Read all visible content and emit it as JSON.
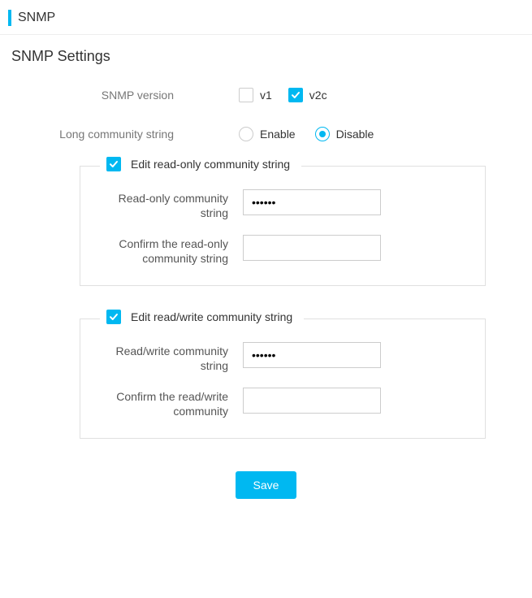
{
  "header": {
    "title": "SNMP"
  },
  "subtitle": "SNMP Settings",
  "version_row": {
    "label": "SNMP version",
    "options": [
      {
        "label": "v1",
        "checked": false
      },
      {
        "label": "v2c",
        "checked": true
      }
    ]
  },
  "longcomm_row": {
    "label": "Long community string",
    "options": [
      {
        "label": "Enable",
        "selected": false
      },
      {
        "label": "Disable",
        "selected": true
      }
    ]
  },
  "panels": {
    "readonly": {
      "legend": "Edit read-only community string",
      "legend_checked": true,
      "fields": [
        {
          "label": "Read-only community string",
          "value": "••••••"
        },
        {
          "label": "Confirm the read-only community string",
          "value": ""
        }
      ]
    },
    "readwrite": {
      "legend": "Edit read/write community string",
      "legend_checked": true,
      "fields": [
        {
          "label": "Read/write community string",
          "value": "••••••"
        },
        {
          "label": "Confirm the read/write community",
          "value": ""
        }
      ]
    }
  },
  "buttons": {
    "save": "Save"
  },
  "colors": {
    "accent": "#00b8f1"
  }
}
